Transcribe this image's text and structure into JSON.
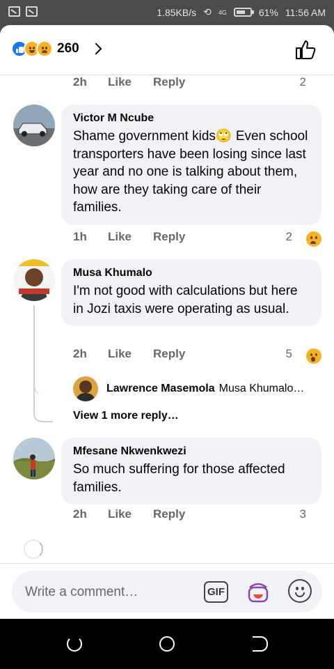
{
  "status_bar": {
    "network_speed": "1.85KB/s",
    "signal_label": "4G",
    "battery": "61%",
    "time": "11:56 AM"
  },
  "reactions_header": {
    "count": "260",
    "reaction_icons": [
      "like-icon",
      "haha-icon",
      "sad-icon"
    ]
  },
  "comments": [
    {
      "time": "2h",
      "like_label": "Like",
      "reply_label": "Reply",
      "reaction_count": "2",
      "reaction_icons": [
        "like-icon"
      ]
    },
    {
      "author": "Victor M Ncube",
      "text": "Shame government kids🙄 Even school transporters have been losing since last year and no one is talking about them, how are they taking care of their families.",
      "time": "1h",
      "like_label": "Like",
      "reply_label": "Reply",
      "reaction_count": "2",
      "reaction_icons": [
        "like-icon",
        "sad-icon"
      ]
    },
    {
      "author": "Musa Khumalo",
      "text": "I'm not good with calculations but here in Jozi taxis were operating as usual.",
      "time": "2h",
      "like_label": "Like",
      "reply_label": "Reply",
      "reaction_count": "5",
      "reaction_icons": [
        "like-icon",
        "wow-icon"
      ],
      "reply_preview": {
        "author": "Lawrence Masemola",
        "snippet": "Musa Khumalo…"
      },
      "view_more": "View 1 more reply…"
    },
    {
      "author": "Mfesane Nkwenkwezi",
      "text": "So much suffering for those affected families.",
      "time": "2h",
      "like_label": "Like",
      "reply_label": "Reply",
      "reaction_count": "3",
      "reaction_icons": [
        "like-icon"
      ]
    }
  ],
  "composer": {
    "placeholder": "Write a comment…",
    "gif_label": "GIF"
  },
  "colors": {
    "accent": "#1877f2",
    "bubble": "#f0f2f5",
    "meta": "#65676b",
    "emoji_yellow": "#f7b125"
  }
}
